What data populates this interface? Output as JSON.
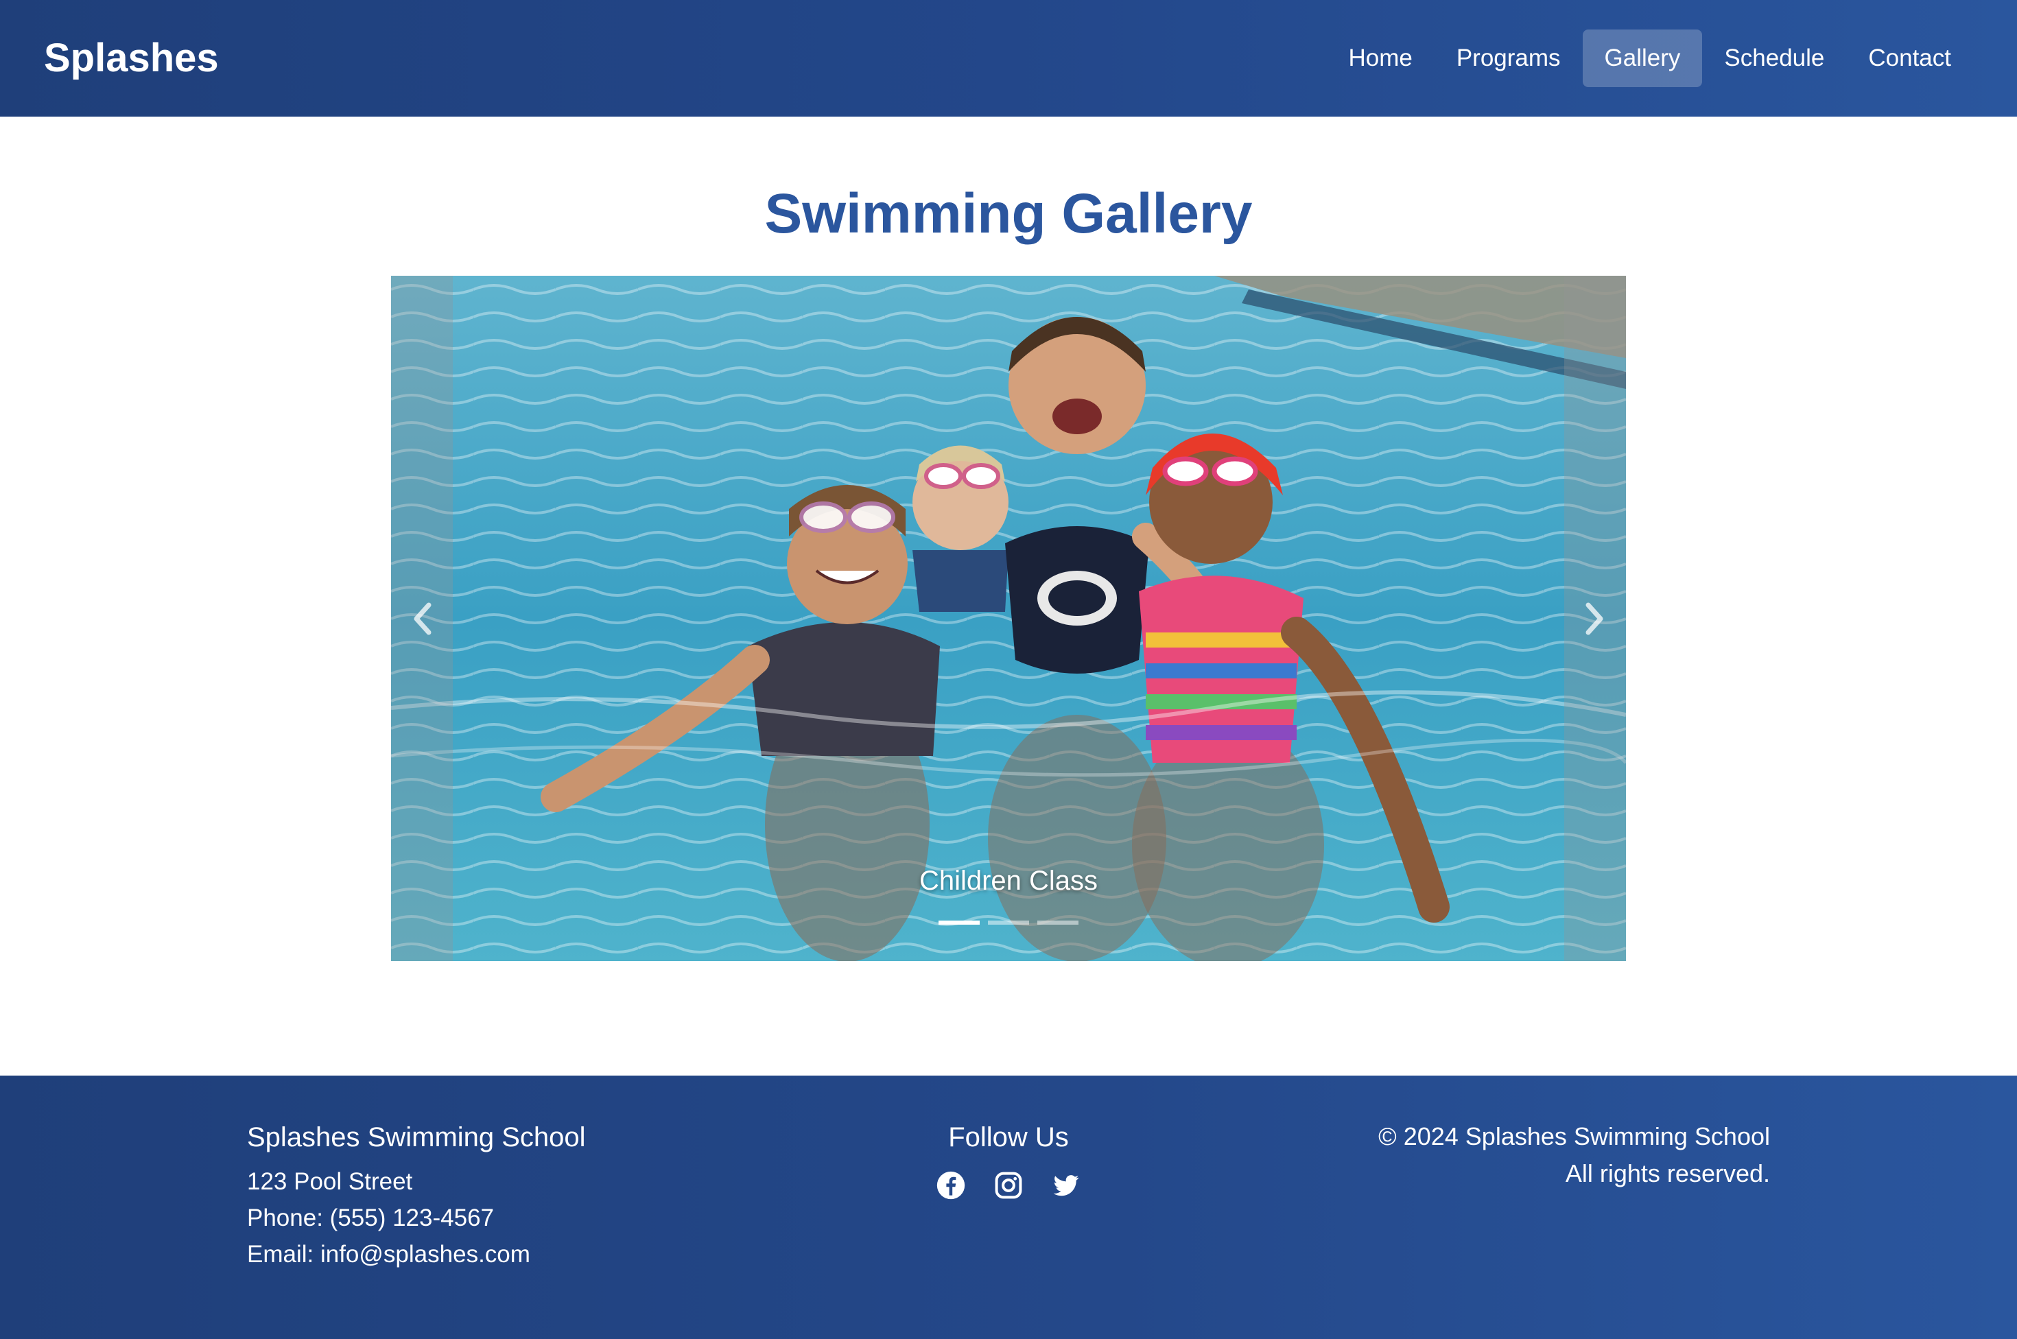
{
  "header": {
    "brand": "Splashes",
    "nav": [
      {
        "label": "Home"
      },
      {
        "label": "Programs"
      },
      {
        "label": "Gallery",
        "active": true
      },
      {
        "label": "Schedule"
      },
      {
        "label": "Contact"
      }
    ]
  },
  "main": {
    "title": "Swimming Gallery",
    "carousel": {
      "caption": "Children Class",
      "slide_count": 3,
      "active_slide": 1,
      "prev_icon": "chevron-left-icon",
      "next_icon": "chevron-right-icon"
    }
  },
  "footer": {
    "contact": {
      "title": "Splashes Swimming School",
      "address": "123 Pool Street",
      "phone": "Phone: (555) 123-4567",
      "email": "Email: info@splashes.com"
    },
    "social": {
      "title": "Follow Us",
      "icons": [
        "facebook-icon",
        "instagram-icon",
        "twitter-icon"
      ]
    },
    "copyright": {
      "line1": "© 2024 Splashes Swimming School",
      "line2": "All rights reserved."
    }
  },
  "colors": {
    "header_bg": "#23478a",
    "accent_title": "#2b569e",
    "pool_water": "#3d9fc0"
  }
}
